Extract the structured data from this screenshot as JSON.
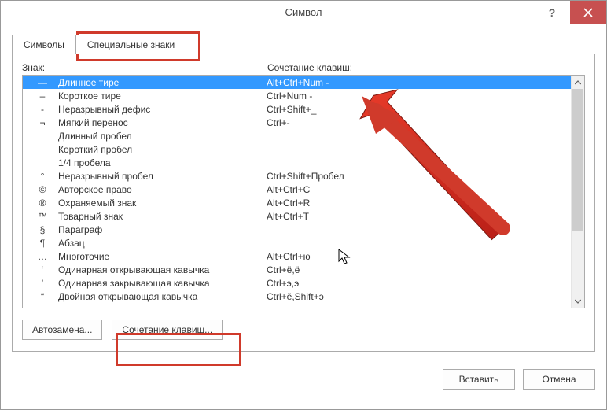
{
  "window": {
    "title": "Символ"
  },
  "tabs": {
    "symbols": "Символы",
    "special": "Специальные знаки"
  },
  "headers": {
    "sign": "Знак:",
    "shortcut": "Сочетание клавиш:"
  },
  "rows": [
    {
      "sym": "—",
      "name": "Длинное тире",
      "short": "Alt+Ctrl+Num -",
      "selected": true
    },
    {
      "sym": "–",
      "name": "Короткое тире",
      "short": "Ctrl+Num -"
    },
    {
      "sym": "-",
      "name": "Неразрывный дефис",
      "short": "Ctrl+Shift+_"
    },
    {
      "sym": "¬",
      "name": "Мягкий перенос",
      "short": "Ctrl+-"
    },
    {
      "sym": "",
      "name": "Длинный пробел",
      "short": ""
    },
    {
      "sym": "",
      "name": "Короткий пробел",
      "short": ""
    },
    {
      "sym": "",
      "name": "1/4 пробела",
      "short": ""
    },
    {
      "sym": "°",
      "name": "Неразрывный пробел",
      "short": "Ctrl+Shift+Пробел"
    },
    {
      "sym": "©",
      "name": "Авторское право",
      "short": "Alt+Ctrl+C"
    },
    {
      "sym": "®",
      "name": "Охраняемый знак",
      "short": "Alt+Ctrl+R"
    },
    {
      "sym": "™",
      "name": "Товарный знак",
      "short": "Alt+Ctrl+T"
    },
    {
      "sym": "§",
      "name": "Параграф",
      "short": ""
    },
    {
      "sym": "¶",
      "name": "Абзац",
      "short": ""
    },
    {
      "sym": "…",
      "name": "Многоточие",
      "short": "Alt+Ctrl+ю"
    },
    {
      "sym": "‘",
      "name": "Одинарная открывающая кавычка",
      "short": "Ctrl+ё,ё"
    },
    {
      "sym": "’",
      "name": "Одинарная закрывающая кавычка",
      "short": "Ctrl+э,э"
    },
    {
      "sym": "“",
      "name": "Двойная открывающая кавычка",
      "short": "Ctrl+ё,Shift+э"
    }
  ],
  "buttons": {
    "autocorrect": "Автозамена...",
    "shortcut": "Сочетание клавиш...",
    "insert": "Вставить",
    "cancel": "Отмена"
  }
}
